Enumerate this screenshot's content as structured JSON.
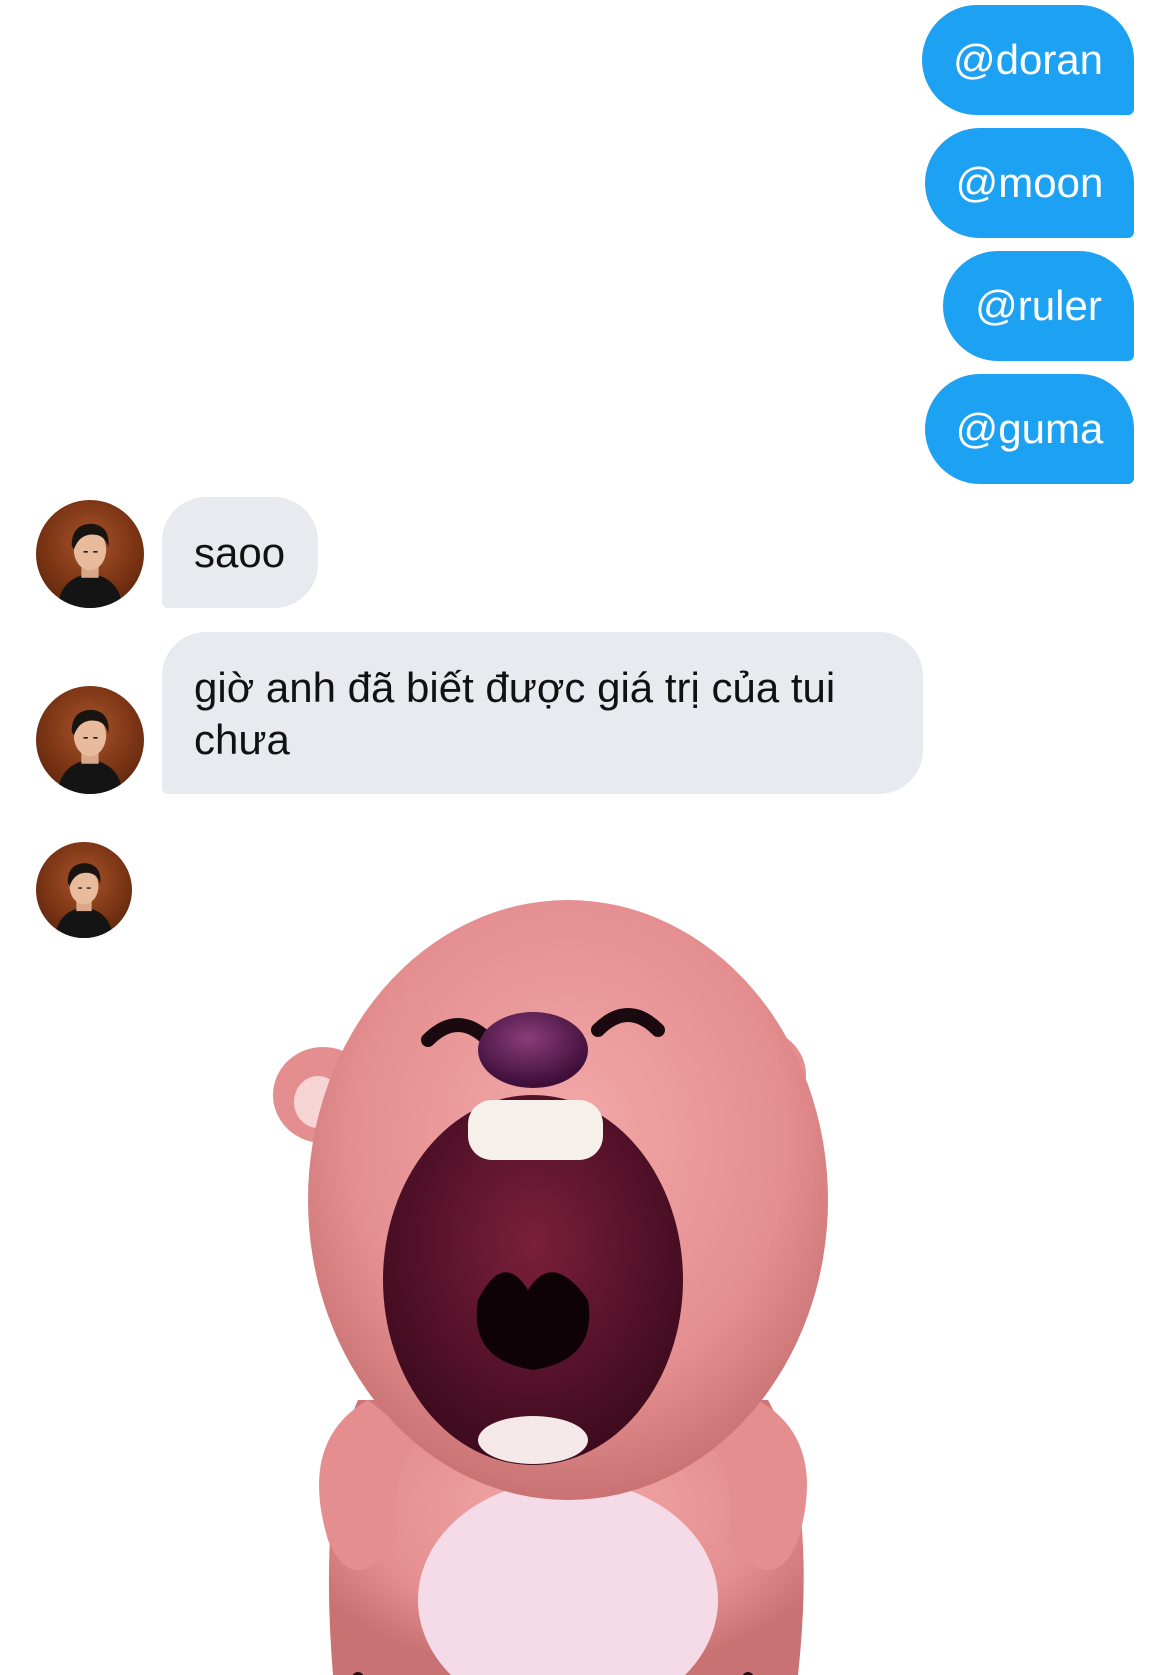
{
  "messages": {
    "sent": [
      {
        "text": "@doran"
      },
      {
        "text": "@moon"
      },
      {
        "text": "@ruler"
      },
      {
        "text": "@guma"
      }
    ],
    "received": [
      {
        "text": "saoo"
      },
      {
        "text": "giờ anh đã biết được giá trị của tui chưa"
      }
    ]
  },
  "colors": {
    "sent_bubble": "#1da1f2",
    "received_bubble": "#e7ebef",
    "sticker_body": "#e9999a"
  },
  "icons": {
    "avatar": "user-avatar-photo",
    "sticker": "pink-beaver-laughing-sticker"
  }
}
